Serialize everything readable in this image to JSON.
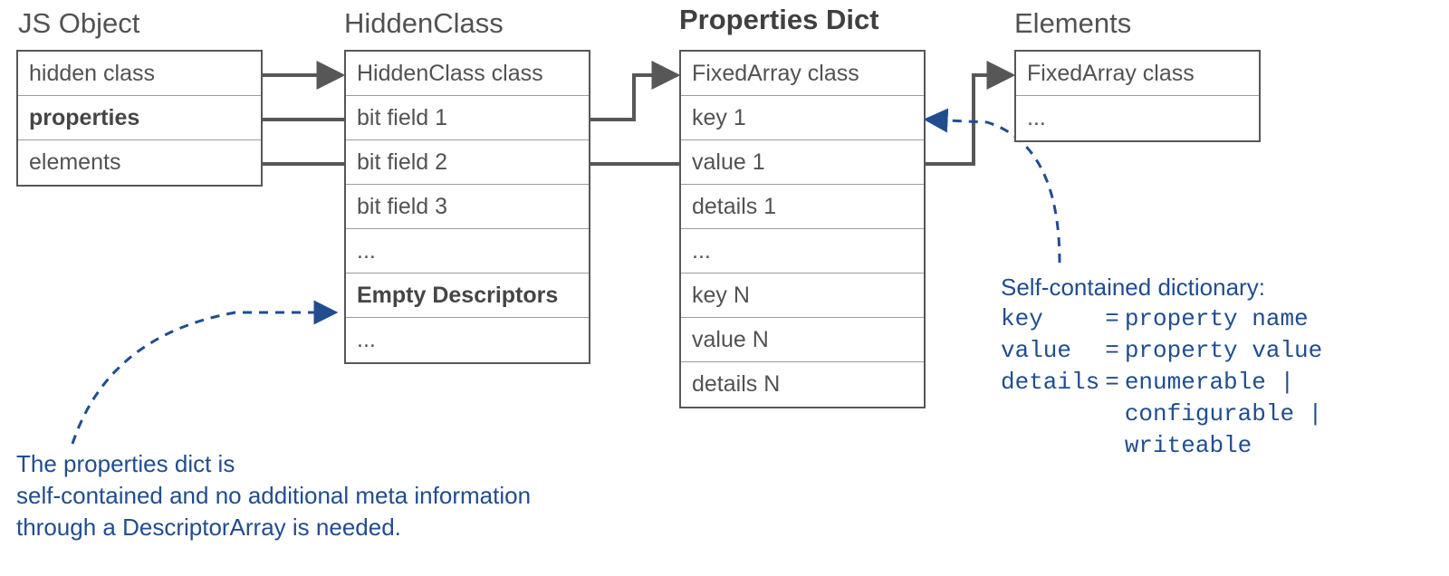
{
  "headings": {
    "jsobject": "JS Object",
    "hiddenclass": "HiddenClass",
    "propdict": "Properties Dict",
    "elements": "Elements"
  },
  "jsobject": {
    "r0": "hidden class",
    "r1": "properties",
    "r2": "elements"
  },
  "hiddenclass": {
    "r0": "HiddenClass class",
    "r1": "bit field 1",
    "r2": "bit field 2",
    "r3": "bit field 3",
    "r4": "...",
    "r5": "Empty Descriptors",
    "r6": "..."
  },
  "propdict": {
    "r0": "FixedArray class",
    "r1": "key 1",
    "r2": "value 1",
    "r3": "details 1",
    "r4": "...",
    "r5": "key N",
    "r6": "value N",
    "r7": "details N"
  },
  "elements": {
    "r0": "FixedArray class",
    "r1": "..."
  },
  "annotation_left_l1": "The properties dict is",
  "annotation_left_l2": "self-contained and no additional meta information",
  "annotation_left_l3": "through a DescriptorArray is needed.",
  "annotation_right_title": "Self-contained dictionary:",
  "annotation_right": {
    "k1": "key",
    "eq": "=",
    "v1": "property name",
    "k2": "value",
    "v2": "property value",
    "k3": "details",
    "v3a": "enumerable   |",
    "v3b": "configurable |",
    "v3c": "writeable"
  }
}
